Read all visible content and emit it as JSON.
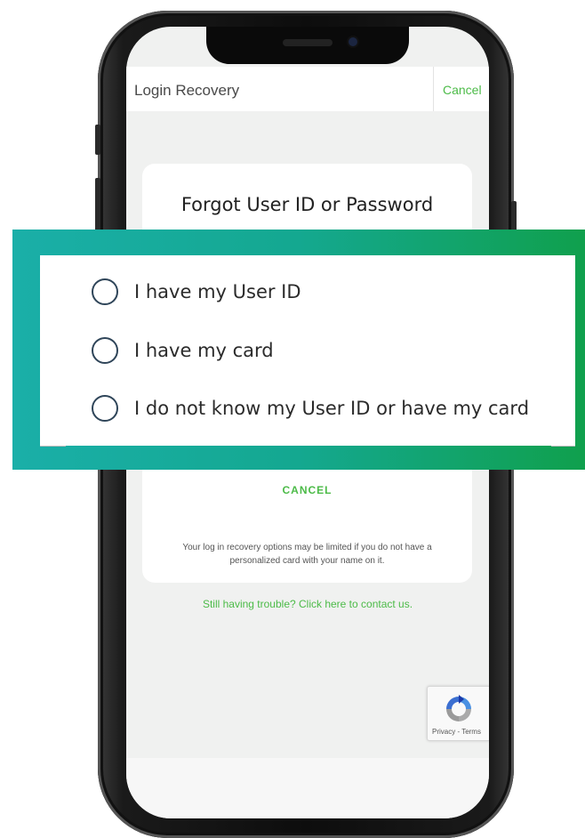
{
  "header": {
    "title": "Login Recovery",
    "cancel_label": "Cancel"
  },
  "card": {
    "title": "Forgot User ID or Password",
    "cancel_label": "CANCEL",
    "note": "Your log in recovery options may be limited if you do not have a personalized card with your name on it."
  },
  "trouble_link": "Still having trouble? Click here to contact us.",
  "recaptcha": {
    "links": "Privacy - Terms"
  },
  "options": [
    {
      "label": "I have my User ID",
      "selected": false
    },
    {
      "label": "I have my card",
      "selected": false
    },
    {
      "label": "I do not know my User ID or have my card",
      "selected": false
    }
  ],
  "colors": {
    "accent_green": "#4cbb48",
    "overlay_start": "#1aafa8",
    "overlay_end": "#10a04d",
    "radio_border": "#2f4559"
  }
}
